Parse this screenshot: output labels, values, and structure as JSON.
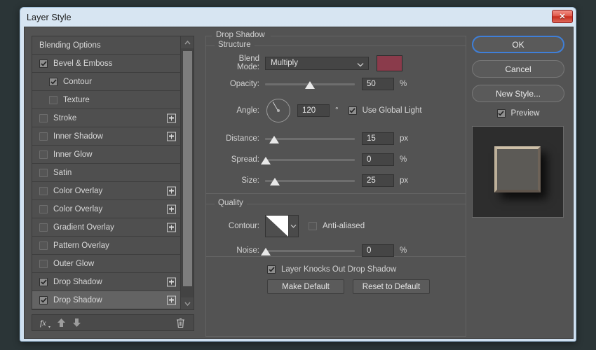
{
  "window": {
    "title": "Layer Style",
    "close_label": "✕"
  },
  "effects_list": {
    "items": [
      {
        "label": "Blending Options",
        "checkbox": "none",
        "indent": false,
        "plus": false,
        "selected": false
      },
      {
        "label": "Bevel & Emboss",
        "checkbox": "checked",
        "indent": false,
        "plus": false,
        "selected": false
      },
      {
        "label": "Contour",
        "checkbox": "checked",
        "indent": true,
        "plus": false,
        "selected": false
      },
      {
        "label": "Texture",
        "checkbox": "unchecked",
        "indent": true,
        "plus": false,
        "selected": false
      },
      {
        "label": "Stroke",
        "checkbox": "unchecked",
        "indent": false,
        "plus": true,
        "selected": false
      },
      {
        "label": "Inner Shadow",
        "checkbox": "unchecked",
        "indent": false,
        "plus": true,
        "selected": false
      },
      {
        "label": "Inner Glow",
        "checkbox": "unchecked",
        "indent": false,
        "plus": false,
        "selected": false
      },
      {
        "label": "Satin",
        "checkbox": "unchecked",
        "indent": false,
        "plus": false,
        "selected": false
      },
      {
        "label": "Color Overlay",
        "checkbox": "unchecked",
        "indent": false,
        "plus": true,
        "selected": false
      },
      {
        "label": "Color Overlay",
        "checkbox": "unchecked",
        "indent": false,
        "plus": true,
        "selected": false
      },
      {
        "label": "Gradient Overlay",
        "checkbox": "unchecked",
        "indent": false,
        "plus": true,
        "selected": false
      },
      {
        "label": "Pattern Overlay",
        "checkbox": "unchecked",
        "indent": false,
        "plus": false,
        "selected": false
      },
      {
        "label": "Outer Glow",
        "checkbox": "unchecked",
        "indent": false,
        "plus": false,
        "selected": false
      },
      {
        "label": "Drop Shadow",
        "checkbox": "checked",
        "indent": false,
        "plus": true,
        "selected": false
      },
      {
        "label": "Drop Shadow",
        "checkbox": "checked",
        "indent": false,
        "plus": true,
        "selected": true
      }
    ]
  },
  "fx_toolbar": {
    "fx_label": "fx",
    "move_up": "move-up",
    "move_down": "move-down",
    "delete": "delete"
  },
  "panel": {
    "effect_title": "Drop Shadow",
    "structure_title": "Structure",
    "quality_title": "Quality",
    "blend_mode_label": "Blend Mode:",
    "blend_mode_value": "Multiply",
    "shadow_color": "#8a3b4b",
    "opacity_label": "Opacity:",
    "opacity_value": "50",
    "opacity_unit": "%",
    "angle_label": "Angle:",
    "angle_value": "120",
    "angle_unit": "°",
    "use_global_light": "Use Global Light",
    "distance_label": "Distance:",
    "distance_value": "15",
    "distance_unit": "px",
    "spread_label": "Spread:",
    "spread_value": "0",
    "spread_unit": "%",
    "size_label": "Size:",
    "size_value": "25",
    "size_unit": "px",
    "contour_label": "Contour:",
    "anti_aliased": "Anti-aliased",
    "noise_label": "Noise:",
    "noise_value": "0",
    "noise_unit": "%",
    "knocks_out": "Layer Knocks Out Drop Shadow",
    "make_default": "Make Default",
    "reset_to_default": "Reset to Default"
  },
  "actions": {
    "ok": "OK",
    "cancel": "Cancel",
    "new_style": "New Style...",
    "preview": "Preview"
  }
}
